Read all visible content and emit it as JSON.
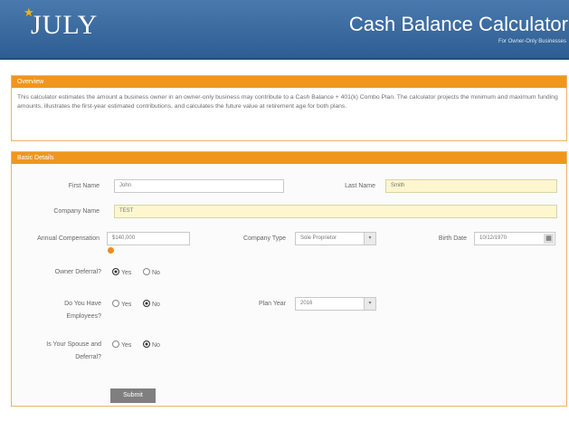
{
  "header": {
    "logo_text": "JULY",
    "title": "Cash Balance Calculator",
    "subtitle": "For Owner-Only Businesses"
  },
  "overview": {
    "heading": "Overview",
    "text": "This calculator estimates the amount a business owner in an owner-only business may contribute to a Cash Balance + 401(k) Combo Plan. The calculator projects the minimum and maximum funding amounts, illustrates the first-year estimated contributions, and calculates the future value at retirement age for both plans."
  },
  "details": {
    "heading": "Basic Details",
    "first_name_label": "First Name",
    "first_name_value": "John",
    "last_name_label": "Last Name",
    "last_name_value": "Smith",
    "company_name_label": "Company Name",
    "company_name_value": "TEST",
    "annual_comp_label": "Annual Compensation",
    "annual_comp_value": "$140,000",
    "company_type_label": "Company Type",
    "company_type_value": "Sole Proprietor",
    "birth_date_label": "Birth Date",
    "birth_date_value": "10/12/1970",
    "owner_deferral_label": "Owner Deferral?",
    "owner_deferral_value": "Yes",
    "spouse_employee_label_1": "Do You Have",
    "spouse_employee_label_2": "Employees?",
    "spouse_employee_value": "No",
    "plan_year_label": "Plan Year",
    "plan_year_value": "2016",
    "spouse_deferral_label_1": "Is Your Spouse and",
    "spouse_deferral_label_2": "Deferral?",
    "spouse_deferral_value": "No",
    "yes_label": "Yes",
    "no_label": "No",
    "submit_label": "Submit"
  },
  "colors": {
    "header_blue": "#2d5d92",
    "accent_orange": "#ef961f",
    "highlight_yellow": "#fdf6cf"
  }
}
